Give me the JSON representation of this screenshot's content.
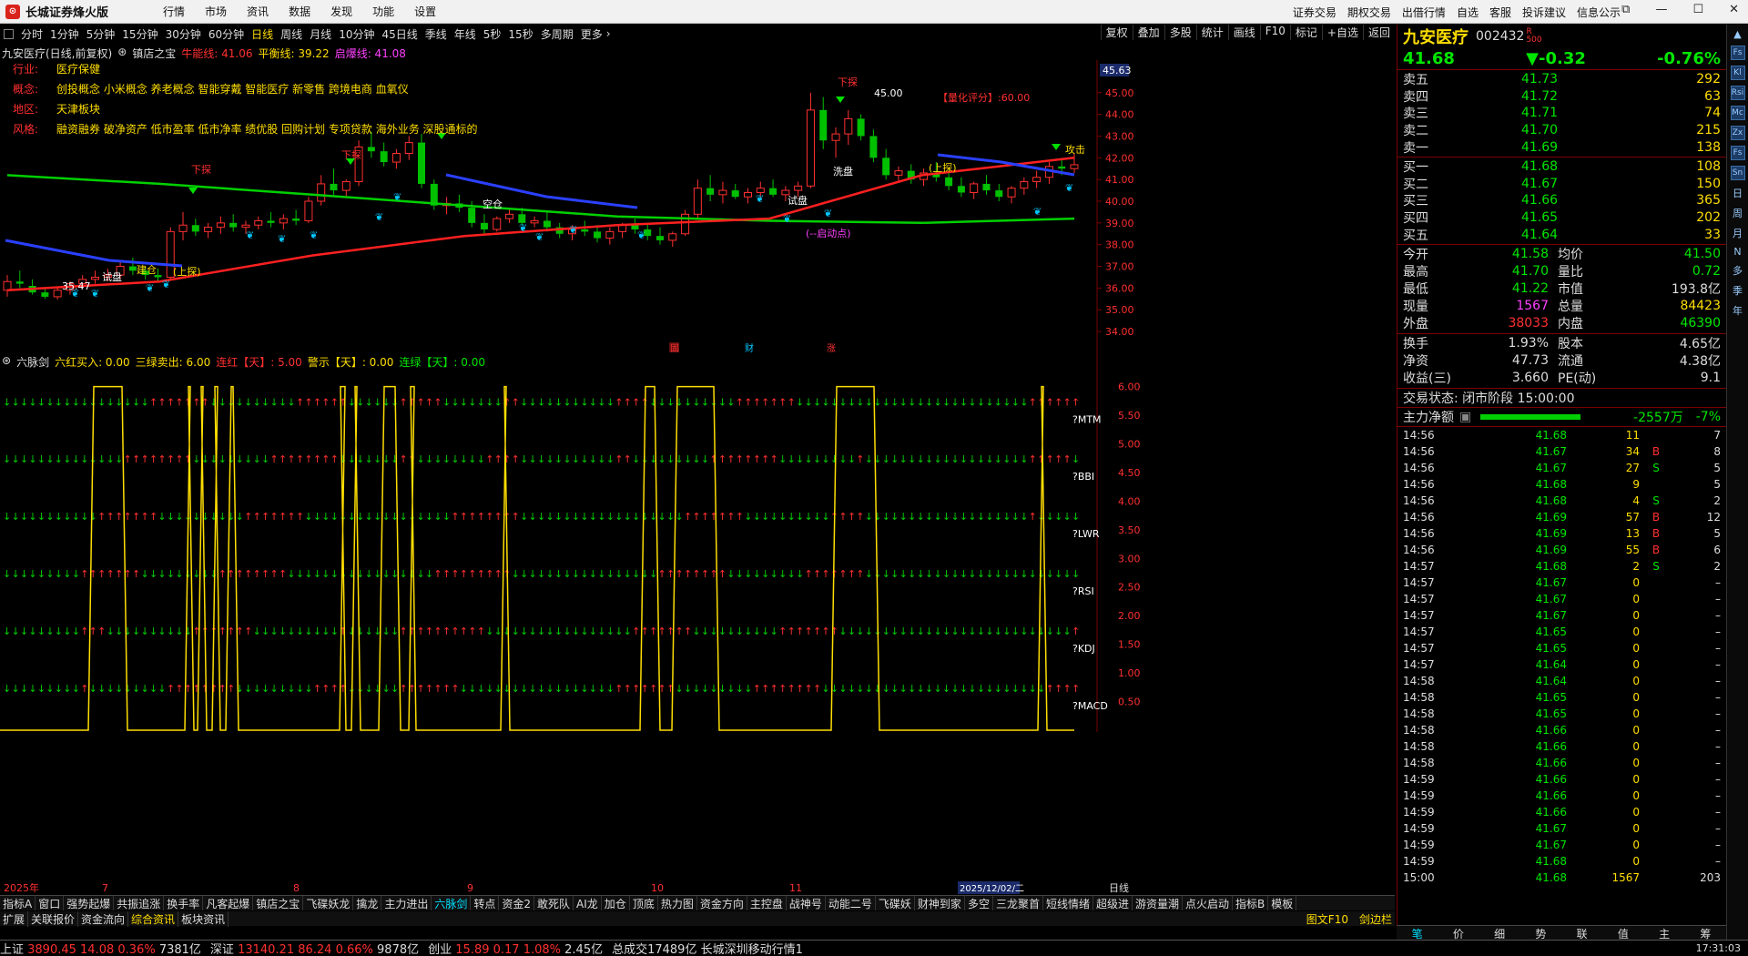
{
  "app": {
    "title": "长城证券烽火版",
    "menus": [
      "行情",
      "市场",
      "资讯",
      "数据",
      "发现",
      "功能",
      "设置"
    ],
    "right_menus": [
      "证券交易",
      "期权交易",
      "出借行情",
      "自选",
      "客服",
      "投诉建议",
      "信息公示"
    ]
  },
  "toolbar": {
    "periods": [
      "分时",
      "1分钟",
      "5分钟",
      "15分钟",
      "30分钟",
      "60分钟",
      "日线",
      "周线",
      "月线",
      "10分钟",
      "45日线",
      "季线",
      "年线",
      "5秒",
      "15秒",
      "多周期",
      "更多"
    ],
    "active": "日线",
    "right_buttons": [
      "复权",
      "叠加",
      "多股",
      "统计",
      "画线",
      "F10",
      "标记",
      "+自选",
      "返回"
    ]
  },
  "chart_header": {
    "title": "九安医疗(日线,前复权)",
    "indicator": "镇店之宝",
    "niuneng": "牛能线: 41.06",
    "pingheng": "平衡线: 39.22",
    "qibao": "启爆线: 41.08"
  },
  "info": {
    "hangye_label": "行业:",
    "hangye": "医疗保健",
    "gainian_label": "概念:",
    "gainian": "创投概念 小米概念 养老概念 智能穿戴 智能医疗 新零售 跨境电商 血氧仪",
    "diqu_label": "地区:",
    "diqu": "天津板块",
    "fengge_label": "风格:",
    "fengge": "融资融券 破净资产 低市盈率 低市净率 绩优股 回购计划 专项贷款 海外业务 深股通标的"
  },
  "annotations": {
    "score": "【量化评分】:60.00",
    "high": "45.00",
    "low": "35.47",
    "start_point": "(--启动点)",
    "b1": "固",
    "b2": "财",
    "b3": "涨",
    "labels": [
      "下探",
      "试盘",
      "建仓",
      "(上探)",
      "空仓",
      "洗盘",
      "试盘",
      "(上探)",
      "下探",
      "攻击",
      "下探"
    ]
  },
  "yaxis": {
    "current": "45.63",
    "ticks": [
      "45.00",
      "44.00",
      "43.00",
      "42.00",
      "41.00",
      "40.00",
      "39.00",
      "38.00",
      "37.00",
      "36.00",
      "35.00",
      "34.00"
    ]
  },
  "sub_header": {
    "name": "六脉剑",
    "a": "六红买入: 0.00",
    "b": "三绿卖出: 6.00",
    "c": "连红【天】: 5.00",
    "d": "警示【天】: 0.00",
    "e": "连绿【天】: 0.00"
  },
  "sub_labels": [
    "?MTM",
    "?BBI",
    "?LWR",
    "?RSI",
    "?KDJ",
    "?MACD"
  ],
  "sub_yaxis": [
    "6.00",
    "5.50",
    "5.00",
    "4.50",
    "4.00",
    "3.50",
    "3.00",
    "2.50",
    "2.00",
    "1.50",
    "1.00",
    "0.50"
  ],
  "xaxis": {
    "labels": [
      "2025年",
      "7",
      "8",
      "9",
      "10",
      "11"
    ],
    "current_date": "2025/12/02/二",
    "mode": "日线"
  },
  "quote": {
    "name": "九安医疗",
    "code": "002432",
    "badge_r": "R",
    "badge_n": "500",
    "price": "41.68",
    "change": "▼-0.32",
    "pct": "-0.76%",
    "asks": [
      [
        "卖五",
        "41.73",
        "292"
      ],
      [
        "卖四",
        "41.72",
        "63"
      ],
      [
        "卖三",
        "41.71",
        "74"
      ],
      [
        "卖二",
        "41.70",
        "215"
      ],
      [
        "卖一",
        "41.69",
        "138"
      ]
    ],
    "bids": [
      [
        "买一",
        "41.68",
        "108"
      ],
      [
        "买二",
        "41.67",
        "150"
      ],
      [
        "买三",
        "41.66",
        "365"
      ],
      [
        "买四",
        "41.65",
        "202"
      ],
      [
        "买五",
        "41.64",
        "33"
      ]
    ],
    "stats": [
      [
        "今开",
        "41.58",
        "g",
        "均价",
        "41.50",
        "g"
      ],
      [
        "最高",
        "41.70",
        "g",
        "量比",
        "0.72",
        "g"
      ],
      [
        "最低",
        "41.22",
        "g",
        "市值",
        "193.8亿",
        "w"
      ],
      [
        "现量",
        "1567",
        "m",
        "总量",
        "84423",
        "y"
      ],
      [
        "外盘",
        "38033",
        "r",
        "内盘",
        "46390",
        "g"
      ]
    ],
    "stats2": [
      [
        "换手",
        "1.93%",
        "股本",
        "4.65亿"
      ],
      [
        "净资",
        "47.73",
        "流通",
        "4.38亿"
      ],
      [
        "收益(三)",
        "3.660",
        "PE(动)",
        "9.1"
      ]
    ],
    "status": "交易状态: 闭市阶段 15:00:00",
    "zl_label": "主力净额",
    "zl_val": "-2557万",
    "zl_pct": "-7%",
    "ticks": [
      [
        "14:56",
        "41.68",
        "11",
        "",
        "7"
      ],
      [
        "14:56",
        "41.67",
        "34",
        "B",
        "8"
      ],
      [
        "14:56",
        "41.67",
        "27",
        "S",
        "5"
      ],
      [
        "14:56",
        "41.68",
        "9",
        "",
        "5"
      ],
      [
        "14:56",
        "41.68",
        "4",
        "S",
        "2"
      ],
      [
        "14:56",
        "41.69",
        "57",
        "B",
        "12"
      ],
      [
        "14:56",
        "41.69",
        "13",
        "B",
        "5"
      ],
      [
        "14:56",
        "41.69",
        "55",
        "B",
        "6"
      ],
      [
        "14:57",
        "41.68",
        "2",
        "S",
        "2"
      ],
      [
        "14:57",
        "41.67",
        "0",
        "",
        "–"
      ],
      [
        "14:57",
        "41.67",
        "0",
        "",
        "–"
      ],
      [
        "14:57",
        "41.67",
        "0",
        "",
        "–"
      ],
      [
        "14:57",
        "41.65",
        "0",
        "",
        "–"
      ],
      [
        "14:57",
        "41.65",
        "0",
        "",
        "–"
      ],
      [
        "14:57",
        "41.64",
        "0",
        "",
        "–"
      ],
      [
        "14:58",
        "41.64",
        "0",
        "",
        "–"
      ],
      [
        "14:58",
        "41.65",
        "0",
        "",
        "–"
      ],
      [
        "14:58",
        "41.65",
        "0",
        "",
        "–"
      ],
      [
        "14:58",
        "41.66",
        "0",
        "",
        "–"
      ],
      [
        "14:58",
        "41.66",
        "0",
        "",
        "–"
      ],
      [
        "14:58",
        "41.66",
        "0",
        "",
        "–"
      ],
      [
        "14:59",
        "41.66",
        "0",
        "",
        "–"
      ],
      [
        "14:59",
        "41.66",
        "0",
        "",
        "–"
      ],
      [
        "14:59",
        "41.66",
        "0",
        "",
        "–"
      ],
      [
        "14:59",
        "41.67",
        "0",
        "",
        "–"
      ],
      [
        "14:59",
        "41.67",
        "0",
        "",
        "–"
      ],
      [
        "14:59",
        "41.68",
        "0",
        "",
        "–"
      ],
      [
        "15:00",
        "41.68",
        "1567",
        "",
        "203"
      ]
    ],
    "tabs": [
      "笔",
      "价",
      "细",
      "势",
      "联",
      "值",
      "主",
      "筹"
    ]
  },
  "side_icons": [
    "Fs",
    "Kl",
    "Rsi",
    "Mc",
    "Zx",
    "Fs",
    "Sn",
    "日",
    "周",
    "月",
    "N",
    "多",
    "季",
    "年"
  ],
  "bottom_tabs1": [
    "指标A",
    "窗口",
    "强势起爆",
    "共振追涨",
    "换手率",
    "凡客起爆",
    "镇店之宝",
    "飞碟妖龙",
    "擒龙",
    "主力进出",
    "六脉剑",
    "转点",
    "资金2",
    "敢死队",
    "AI龙",
    "加仓",
    "顶底",
    "热力图",
    "资金方向",
    "主控盘",
    "战神号",
    "动能二号",
    "飞碟妖",
    "财神到家",
    "多空",
    "三龙聚首",
    "短线情绪",
    "超级进",
    "游资量潮",
    "点火启动",
    "指标B",
    "模板"
  ],
  "bottom_tabs2": [
    "扩展",
    "关联报价",
    "资金流向",
    "综合资讯",
    "板块资讯"
  ],
  "bottom_tabs2_right": [
    "图文F10",
    "剑边栏"
  ],
  "statusbar": [
    [
      "上证",
      "3890.45",
      "14.08",
      "0.36%",
      "7381亿"
    ],
    [
      "深证",
      "13140.21",
      "86.24",
      "0.66%",
      "9878亿"
    ],
    [
      "创业",
      "15.89",
      "0.17",
      "1.08%",
      "2.45亿"
    ]
  ],
  "statusbar_extra": "总成交17489亿 长城深圳移动行情1",
  "clock": "17:31:03",
  "chart_data": {
    "type": "candlestick",
    "ylim": [
      33.5,
      46.5
    ],
    "candles": [
      [
        35.9,
        36.6,
        35.6,
        36.3
      ],
      [
        36.3,
        36.8,
        36.0,
        36.2
      ],
      [
        36.1,
        36.4,
        35.7,
        35.8
      ],
      [
        35.8,
        36.0,
        35.5,
        35.6
      ],
      [
        35.6,
        36.0,
        35.47,
        35.9
      ],
      [
        35.9,
        36.3,
        35.7,
        36.2
      ],
      [
        36.2,
        36.6,
        36.0,
        36.4
      ],
      [
        36.4,
        36.8,
        36.2,
        36.5
      ],
      [
        36.5,
        36.9,
        36.3,
        36.6
      ],
      [
        36.6,
        37.2,
        36.4,
        37.0
      ],
      [
        37.0,
        37.4,
        36.6,
        36.8
      ],
      [
        36.8,
        37.0,
        36.4,
        36.6
      ],
      [
        36.6,
        36.9,
        36.3,
        36.5
      ],
      [
        36.5,
        38.8,
        36.4,
        38.6
      ],
      [
        38.6,
        39.5,
        38.2,
        38.9
      ],
      [
        38.9,
        39.2,
        38.4,
        38.6
      ],
      [
        38.6,
        39.0,
        38.3,
        38.8
      ],
      [
        38.8,
        39.3,
        38.5,
        39.0
      ],
      [
        39.0,
        39.4,
        38.6,
        38.8
      ],
      [
        38.8,
        39.1,
        38.5,
        38.9
      ],
      [
        38.9,
        39.3,
        38.7,
        39.1
      ],
      [
        39.1,
        39.5,
        38.8,
        39.0
      ],
      [
        39.0,
        39.4,
        38.7,
        39.2
      ],
      [
        39.2,
        39.6,
        38.9,
        39.1
      ],
      [
        39.1,
        40.2,
        39.0,
        40.0
      ],
      [
        40.0,
        41.2,
        39.8,
        40.8
      ],
      [
        40.8,
        41.5,
        40.3,
        40.5
      ],
      [
        40.5,
        41.0,
        40.2,
        40.9
      ],
      [
        40.9,
        42.8,
        40.7,
        42.5
      ],
      [
        42.5,
        43.2,
        42.0,
        42.3
      ],
      [
        42.3,
        42.7,
        41.6,
        41.8
      ],
      [
        41.8,
        42.4,
        41.5,
        42.2
      ],
      [
        42.2,
        43.0,
        41.9,
        42.7
      ],
      [
        42.7,
        43.1,
        40.6,
        40.8
      ],
      [
        40.8,
        41.0,
        39.6,
        39.8
      ],
      [
        39.8,
        40.2,
        39.4,
        39.9
      ],
      [
        39.9,
        40.3,
        39.5,
        39.7
      ],
      [
        39.7,
        40.0,
        38.8,
        39.0
      ],
      [
        39.0,
        39.4,
        38.5,
        38.7
      ],
      [
        38.7,
        39.3,
        38.6,
        39.2
      ],
      [
        39.2,
        39.6,
        39.0,
        39.4
      ],
      [
        39.4,
        39.7,
        38.9,
        39.0
      ],
      [
        39.0,
        39.3,
        38.8,
        39.1
      ],
      [
        39.1,
        39.5,
        38.6,
        38.8
      ],
      [
        38.8,
        39.0,
        38.3,
        38.5
      ],
      [
        38.5,
        38.9,
        38.2,
        38.7
      ],
      [
        38.7,
        39.1,
        38.4,
        38.6
      ],
      [
        38.6,
        38.9,
        38.1,
        38.3
      ],
      [
        38.3,
        38.8,
        38.0,
        38.6
      ],
      [
        38.6,
        39.0,
        38.3,
        38.9
      ],
      [
        38.9,
        39.2,
        38.5,
        38.7
      ],
      [
        38.7,
        39.0,
        38.2,
        38.4
      ],
      [
        38.4,
        38.8,
        38.0,
        38.2
      ],
      [
        38.2,
        38.6,
        37.9,
        38.5
      ],
      [
        38.5,
        39.6,
        38.4,
        39.4
      ],
      [
        39.4,
        41.0,
        39.2,
        40.6
      ],
      [
        40.6,
        41.2,
        40.0,
        40.3
      ],
      [
        40.3,
        40.9,
        39.9,
        40.5
      ],
      [
        40.5,
        40.8,
        40.1,
        40.2
      ],
      [
        40.2,
        40.6,
        39.9,
        40.4
      ],
      [
        40.4,
        40.9,
        40.1,
        40.6
      ],
      [
        40.6,
        41.0,
        40.2,
        40.3
      ],
      [
        40.3,
        40.7,
        40.0,
        40.5
      ],
      [
        40.5,
        40.9,
        40.2,
        40.7
      ],
      [
        40.7,
        45.0,
        40.6,
        44.2
      ],
      [
        44.2,
        44.8,
        42.4,
        42.8
      ],
      [
        42.8,
        43.4,
        42.0,
        43.1
      ],
      [
        43.1,
        44.2,
        42.6,
        43.8
      ],
      [
        43.8,
        44.0,
        42.8,
        43.0
      ],
      [
        43.0,
        43.3,
        41.8,
        42.0
      ],
      [
        42.0,
        42.4,
        41.0,
        41.2
      ],
      [
        41.2,
        41.6,
        40.9,
        41.4
      ],
      [
        41.4,
        41.7,
        40.8,
        41.0
      ],
      [
        41.0,
        41.5,
        40.7,
        41.3
      ],
      [
        41.3,
        41.8,
        40.9,
        41.1
      ],
      [
        41.1,
        41.4,
        40.5,
        40.7
      ],
      [
        40.7,
        41.1,
        40.2,
        40.4
      ],
      [
        40.4,
        40.9,
        40.1,
        40.8
      ],
      [
        40.8,
        41.2,
        40.3,
        40.5
      ],
      [
        40.5,
        40.8,
        40.0,
        40.2
      ],
      [
        40.2,
        40.7,
        39.9,
        40.6
      ],
      [
        40.6,
        41.1,
        40.3,
        40.9
      ],
      [
        40.9,
        41.4,
        40.6,
        41.1
      ],
      [
        41.1,
        41.8,
        40.8,
        41.6
      ],
      [
        41.6,
        42.0,
        41.2,
        41.5
      ],
      [
        41.5,
        42.2,
        41.3,
        41.68
      ]
    ],
    "ma_green_values": [
      41.2,
      40.8,
      40.3,
      39.8,
      39.3,
      39.1,
      39.0,
      39.2
    ],
    "ma_red_values": [
      35.9,
      36.3,
      37.5,
      38.4,
      38.9,
      39.2,
      41.2,
      42.0
    ],
    "sub_series": "lumaijian",
    "sub_ylim": [
      0,
      6
    ]
  }
}
